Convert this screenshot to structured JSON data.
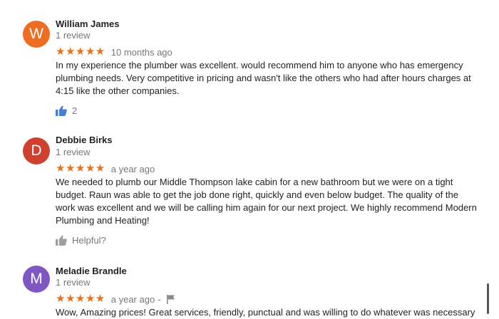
{
  "reviews": [
    {
      "initial": "W",
      "avatar_color": "#ef6c23",
      "name": "William James",
      "review_count": "1 review",
      "stars": "★★★★★",
      "time": "10 months ago",
      "text": "In my experience the plumber was excellent. would recommend him to anyone who has emergency\nplumbing needs. Very competitive in pricing and wasn't like the others who had after hours charges at\n4:15 like the other companies.",
      "likes": "2"
    },
    {
      "initial": "D",
      "avatar_color": "#d0402f",
      "name": "Debbie Birks",
      "review_count": "1 review",
      "stars": "★★★★★",
      "time": "a year ago",
      "text": "We needed to plumb our Middle Thompson lake cabin for a new bathroom but we were on a tight\nbudget.  Raun was able to get the job done right, quickly and even below budget.  The quality of the\nwork was excellent and we will be calling him again for our next project.  We highly recommend Modern\nPlumbing and Heating!",
      "helpful_label": "Helpful?"
    },
    {
      "initial": "M",
      "avatar_color": "#7e57c2",
      "name": "Meladie Brandle",
      "review_count": "1 review",
      "stars": "★★★★★",
      "time": "a year ago",
      "dash": "-",
      "text": "Wow, Amazing prices! Great services, friendly, punctual and was willing to do whatever was necessary"
    }
  ]
}
